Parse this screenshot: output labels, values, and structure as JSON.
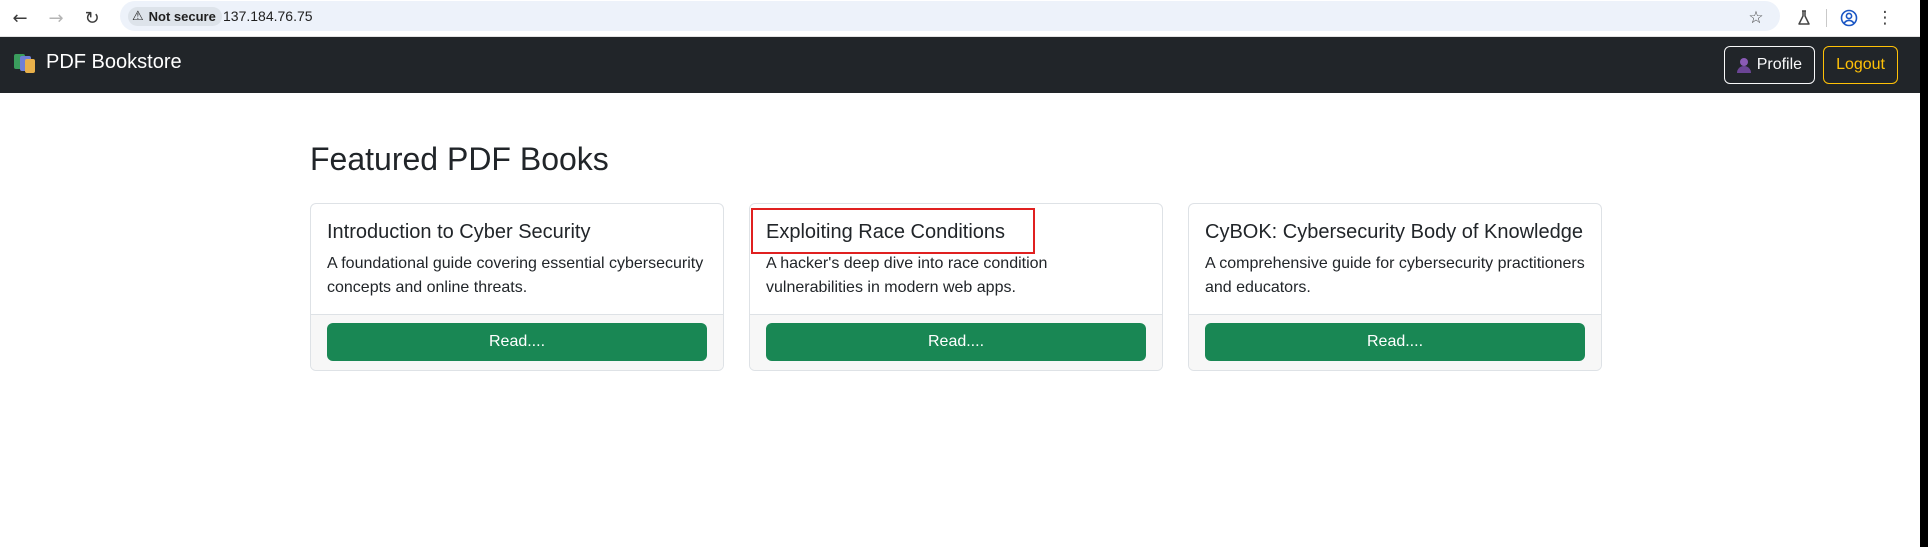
{
  "browser": {
    "security_label": "Not secure",
    "url": "137.184.76.75",
    "icons": [
      "back-icon",
      "forward-icon",
      "reload-icon",
      "warning-icon",
      "bookmark-star-icon",
      "labs-flask-icon",
      "account-icon",
      "menu-kebab-icon"
    ]
  },
  "navbar": {
    "brand": "PDF Bookstore",
    "profile_label": "Profile",
    "logout_label": "Logout"
  },
  "main": {
    "heading": "Featured PDF Books",
    "books": [
      {
        "title": "Introduction to Cyber Security",
        "description": "A foundational guide covering essential cybersecurity concepts and online threats.",
        "button": "Read...."
      },
      {
        "title": "Exploiting Race Conditions",
        "description": "A hacker's deep dive into race condition vulnerabilities in modern web apps.",
        "button": "Read...."
      },
      {
        "title": "CyBOK: Cybersecurity Body of Knowledge",
        "description": "A comprehensive guide for cybersecurity practitioners and educators.",
        "button": "Read...."
      }
    ]
  },
  "colors": {
    "navbar_bg": "#212529",
    "read_button": "#198754",
    "logout_accent": "#ffc107",
    "highlight": "#e02020"
  }
}
